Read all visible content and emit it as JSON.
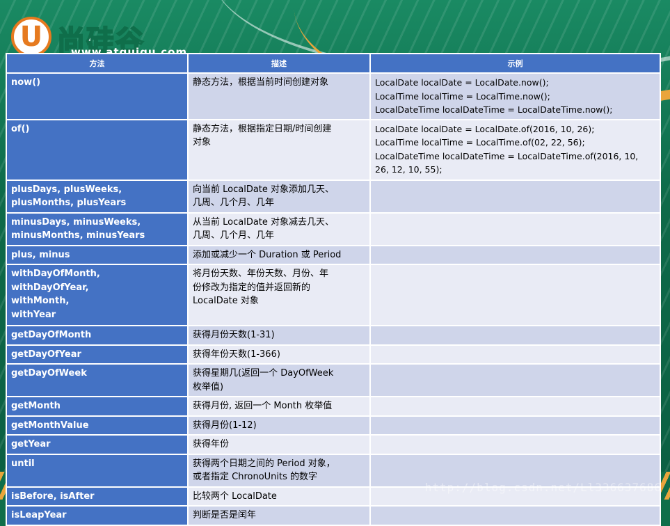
{
  "logo": {
    "badge": "U",
    "name": "尚硅谷",
    "url": "www.atguigu.com"
  },
  "headers": [
    "方法",
    "描述",
    "示例"
  ],
  "rows": [
    {
      "method": [
        "now()"
      ],
      "desc": [
        "静态方法，根据当前时间创建对象"
      ],
      "example": [
        "LocalDate localDate = LocalDate.now();",
        "LocalTime localTime = LocalTime.now();",
        "LocalDateTime localDateTime = LocalDateTime.now();"
      ]
    },
    {
      "method": [
        "of()"
      ],
      "desc": [
        "静态方法，根据指定日期/时间创建",
        "对象"
      ],
      "example": [
        "LocalDate localDate = LocalDate.of(2016, 10, 26);",
        "LocalTime localTime = LocalTime.of(02, 22, 56);",
        "LocalDateTime localDateTime = LocalDateTime.of(2016, 10,",
        "26, 12, 10, 55);"
      ]
    },
    {
      "method": [
        "plusDays, plusWeeks,",
        "plusMonths, plusYears"
      ],
      "desc": [
        "向当前 LocalDate 对象添加几天、",
        "几周、几个月、几年"
      ],
      "example": []
    },
    {
      "method": [
        "minusDays, minusWeeks,",
        "minusMonths, minusYears"
      ],
      "desc": [
        "从当前 LocalDate 对象减去几天、",
        "几周、几个月、几年"
      ],
      "example": []
    },
    {
      "method": [
        "plus, minus"
      ],
      "desc": [
        "添加或减少一个 Duration 或 Period"
      ],
      "example": []
    },
    {
      "method": [
        "withDayOfMonth,",
        "withDayOfYear,",
        "withMonth,",
        "withYear"
      ],
      "desc": [
        "将月份天数、年份天数、月份、年",
        "份修改为指定的值并返回新的",
        "LocalDate 对象"
      ],
      "example": []
    },
    {
      "method": [
        "getDayOfMonth"
      ],
      "desc": [
        "获得月份天数(1-31)"
      ],
      "example": []
    },
    {
      "method": [
        "getDayOfYear"
      ],
      "desc": [
        "获得年份天数(1-366)"
      ],
      "example": []
    },
    {
      "method": [
        "getDayOfWeek"
      ],
      "desc": [
        "获得星期几(返回一个 DayOfWeek",
        "枚举值)"
      ],
      "example": []
    },
    {
      "method": [
        "getMonth"
      ],
      "desc": [
        "获得月份, 返回一个 Month 枚举值"
      ],
      "example": []
    },
    {
      "method": [
        "getMonthValue"
      ],
      "desc": [
        "获得月份(1-12)"
      ],
      "example": []
    },
    {
      "method": [
        "getYear"
      ],
      "desc": [
        "获得年份"
      ],
      "example": []
    },
    {
      "method": [
        "until"
      ],
      "desc": [
        "获得两个日期之间的 Period 对象，",
        "或者指定 ChronoUnits 的数字"
      ],
      "example": []
    },
    {
      "method": [
        "isBefore, isAfter"
      ],
      "desc": [
        "比较两个 LocalDate"
      ],
      "example": []
    },
    {
      "method": [
        "isLeapYear"
      ],
      "desc": [
        "判断是否是闰年"
      ],
      "example": []
    }
  ],
  "watermark": "http://blog.csdn.net/Ll336637686",
  "colors": {
    "header": "#4472c4",
    "row_dark": "#cfd5ea",
    "row_light": "#e9ebf5",
    "accent": "#e67a1f"
  }
}
